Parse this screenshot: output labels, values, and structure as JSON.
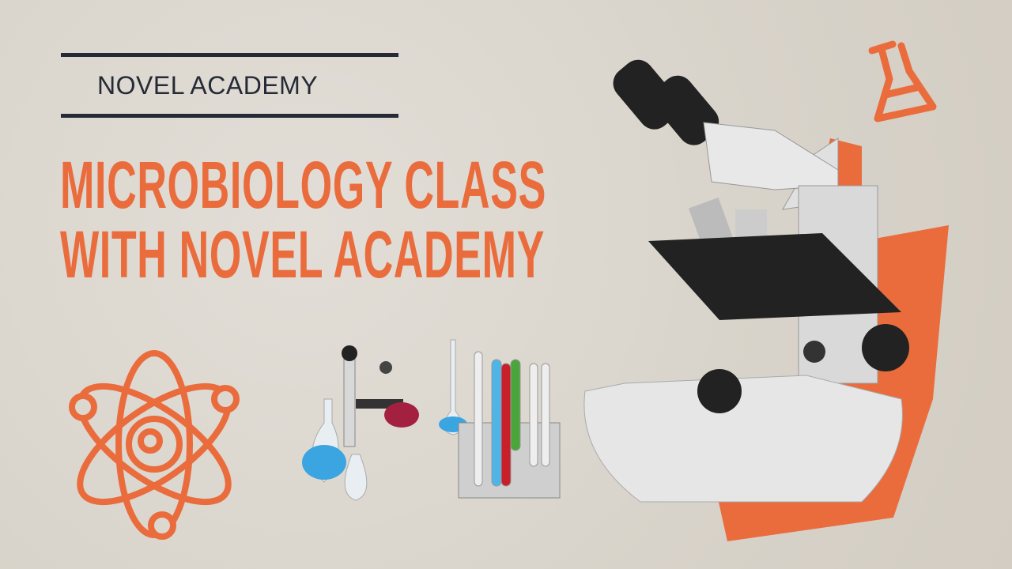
{
  "header": {
    "brand": "NOVEL ACADEMY"
  },
  "title": {
    "line1": "MICROBIOLOGY CLASS",
    "line2": "WITH NOVEL ACADEMY"
  },
  "colors": {
    "accent": "#ea6c3c",
    "dark": "#252a36",
    "background": "#dcd7cf"
  },
  "icons": [
    "atom-icon",
    "flask-icon",
    "microscope-image",
    "lab-glassware-image",
    "test-tubes-image"
  ]
}
